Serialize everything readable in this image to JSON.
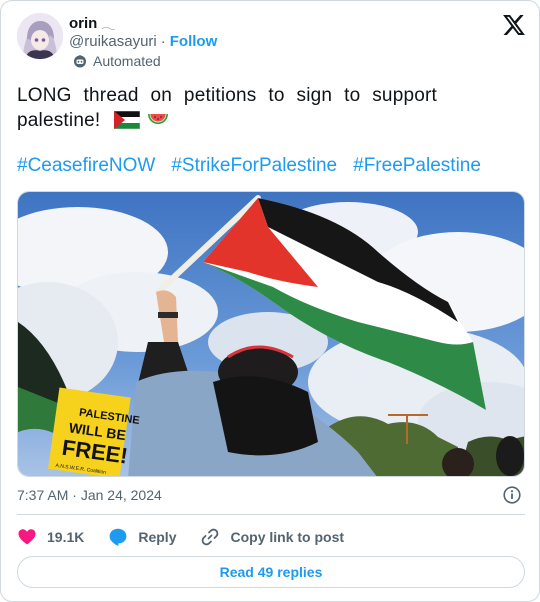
{
  "author": {
    "display_name": "orin",
    "name_glyph": "𓂃",
    "handle": "@ruikasayuri",
    "separator": "·",
    "follow_label": "Follow",
    "automated_label": "Automated"
  },
  "tweet": {
    "text": "LONG thread on petitions to sign to support palestine!",
    "hashtags": [
      "#CeasefireNOW",
      "#StrikeForPalestine",
      "#FreePalestine"
    ]
  },
  "media": {
    "sign_line1": "PALESTINE",
    "sign_line2": "WILL BE",
    "sign_line3": "FREE!",
    "sign_footer": "A.N.S.W.E.R. Coalition"
  },
  "meta": {
    "time": "7:37 AM",
    "separator": "·",
    "date": "Jan 24, 2024"
  },
  "actions": {
    "like_count": "19.1K",
    "reply_label": "Reply",
    "copy_link_label": "Copy link to post"
  },
  "read_replies_label": "Read 49 replies",
  "colors": {
    "accent": "#1d9bf0",
    "like": "#f91880",
    "muted": "#536471",
    "border": "#cfd9de"
  },
  "icons": [
    "x-logo-icon",
    "automated-bot-icon",
    "info-icon",
    "heart-icon",
    "reply-bubble-icon",
    "link-icon",
    "palestine-flag-emoji",
    "watermelon-emoji"
  ]
}
